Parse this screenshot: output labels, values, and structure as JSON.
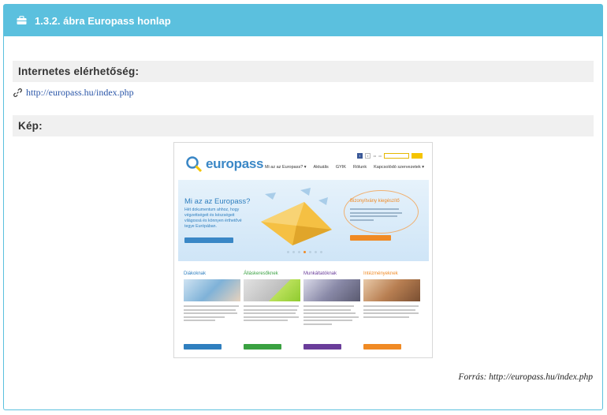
{
  "panel": {
    "title": "1.3.2. ábra Europass honlap",
    "header_color": "#5bc0de"
  },
  "sections": {
    "link_heading": "Internetes elérhetőség:",
    "image_heading": "Kép:"
  },
  "link": {
    "icon": "link-icon",
    "text": "http://europass.hu/index.php"
  },
  "caption": "Forrás: http://europass.hu/index.php",
  "screenshot": {
    "logo_text": "europass",
    "nav": [
      "Mi az az Europass? ▾",
      "Aktuális",
      "GYIK",
      "Rólunk",
      "Kapcsolódó szervezetek ▾"
    ],
    "hero_title": "Mi az az Europass?",
    "hero_text": "Hét dokumentum ahhoz, hogy végzettségeit és készségeit világossá és könnyen érthetővé tegye Európában.",
    "callout_title": "Bizonyítvány kiegészítő",
    "columns": [
      {
        "title": "Diákoknak",
        "color": "#2f7fbf"
      },
      {
        "title": "Álláskeresőknek",
        "color": "#3aa141"
      },
      {
        "title": "Munkáltatóknak",
        "color": "#6a3d9a"
      },
      {
        "title": "Intézményeknek",
        "color": "#f08a24"
      }
    ]
  }
}
